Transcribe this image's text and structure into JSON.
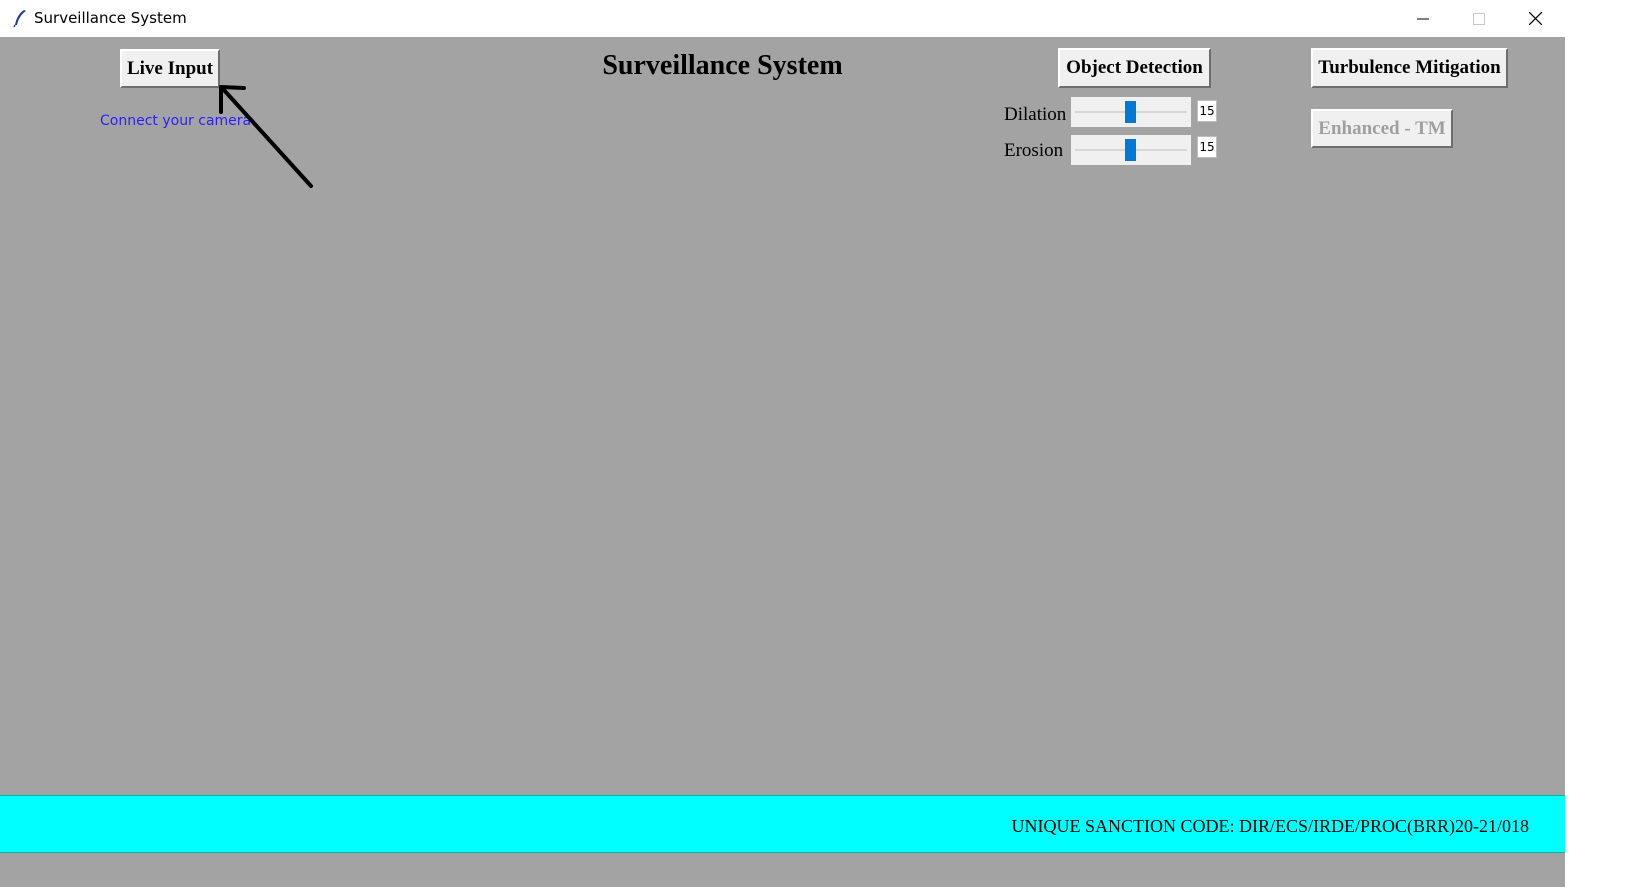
{
  "window": {
    "title": "Surveillance System",
    "controls": [
      "minimize-icon",
      "maximize-icon",
      "close-icon"
    ]
  },
  "header": {
    "title": "Surveillance System"
  },
  "buttons": {
    "live_input": "Live Input",
    "object_detection": "Object Detection",
    "turbulence_mitigation": "Turbulence Mitigation",
    "enhanced_tm": "Enhanced - TM"
  },
  "hint": {
    "connect_camera": "Connect your camera"
  },
  "sliders": [
    {
      "label": "Dilation",
      "value": "15"
    },
    {
      "label": "Erosion",
      "value": "15"
    }
  ],
  "footer": {
    "sanction_code": "UNIQUE SANCTION CODE: DIR/ECS/IRDE/PROC(BRR)20-21/018"
  },
  "colors": {
    "background": "#a3a3a3",
    "footer": "#00ffff",
    "accent": "#0078d7",
    "link": "#2b1fff"
  }
}
